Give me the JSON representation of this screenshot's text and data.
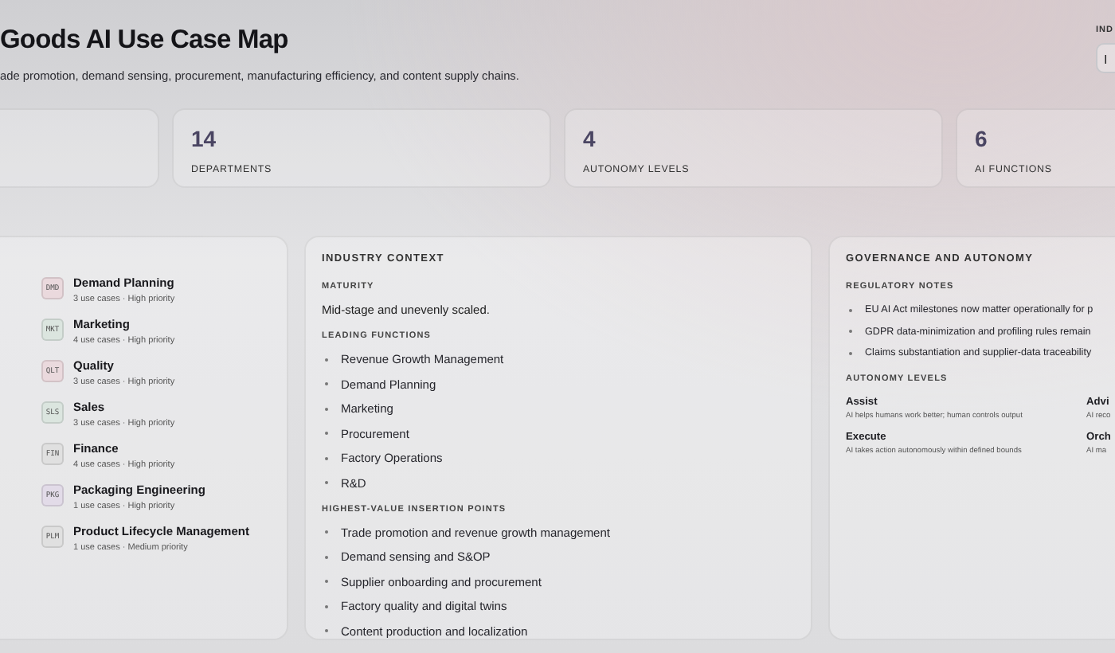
{
  "header": {
    "title": "Goods AI Use Case Map",
    "subtitle": "ade promotion, demand sensing, procurement, manufacturing efficiency, and content supply chains.",
    "filter": {
      "label": "IND",
      "value": "I"
    }
  },
  "stats": [
    {
      "value": "14",
      "label": "DEPARTMENTS"
    },
    {
      "value": "4",
      "label": "AUTONOMY LEVELS"
    },
    {
      "value": "6",
      "label": "AI FUNCTIONS"
    }
  ],
  "departments": [
    {
      "code": "DMD",
      "name": "Demand Planning",
      "meta": "3 use cases · High priority",
      "color": "#ead9dd"
    },
    {
      "code": "MKT",
      "name": "Marketing",
      "meta": "4 use cases · High priority",
      "color": "#dbe5df"
    },
    {
      "code": "QLT",
      "name": "Quality",
      "meta": "3 use cases · High priority",
      "color": "#ead9dd"
    },
    {
      "code": "SLS",
      "name": "Sales",
      "meta": "3 use cases · High priority",
      "color": "#dbe5df"
    },
    {
      "code": "FIN",
      "name": "Finance",
      "meta": "4 use cases · High priority",
      "color": "#e0e0e0"
    },
    {
      "code": "PKG",
      "name": "Packaging Engineering",
      "meta": "1 use cases · High priority",
      "color": "#e2dbe8"
    },
    {
      "code": "PLM",
      "name": "Product Lifecycle Management",
      "meta": "1 use cases · Medium priority",
      "color": "#e0e0e0"
    }
  ],
  "industry_context": {
    "heading": "INDUSTRY CONTEXT",
    "maturity_label": "MATURITY",
    "maturity": "Mid-stage and unevenly scaled.",
    "leading_label": "LEADING FUNCTIONS",
    "leading_functions": [
      "Revenue Growth Management",
      "Demand Planning",
      "Marketing",
      "Procurement",
      "Factory Operations",
      "R&D"
    ],
    "insertion_label": "HIGHEST-VALUE INSERTION POINTS",
    "insertion_points": [
      "Trade promotion and revenue growth management",
      "Demand sensing and S&OP",
      "Supplier onboarding and procurement",
      "Factory quality and digital twins",
      "Content production and localization"
    ]
  },
  "governance": {
    "heading": "GOVERNANCE AND AUTONOMY",
    "notes_label": "REGULATORY NOTES",
    "notes": [
      "EU AI Act milestones now matter operationally for p",
      "GDPR data-minimization and profiling rules remain",
      "Claims substantiation and supplier-data traceability"
    ],
    "levels_label": "AUTONOMY LEVELS",
    "levels": [
      {
        "name": "Assist",
        "description": "AI helps humans work better; human controls output"
      },
      {
        "name": "Advi",
        "description": "AI reco"
      },
      {
        "name": "Execute",
        "description": "AI takes action autonomously within defined bounds"
      },
      {
        "name": "Orch",
        "description": "AI ma"
      }
    ]
  }
}
